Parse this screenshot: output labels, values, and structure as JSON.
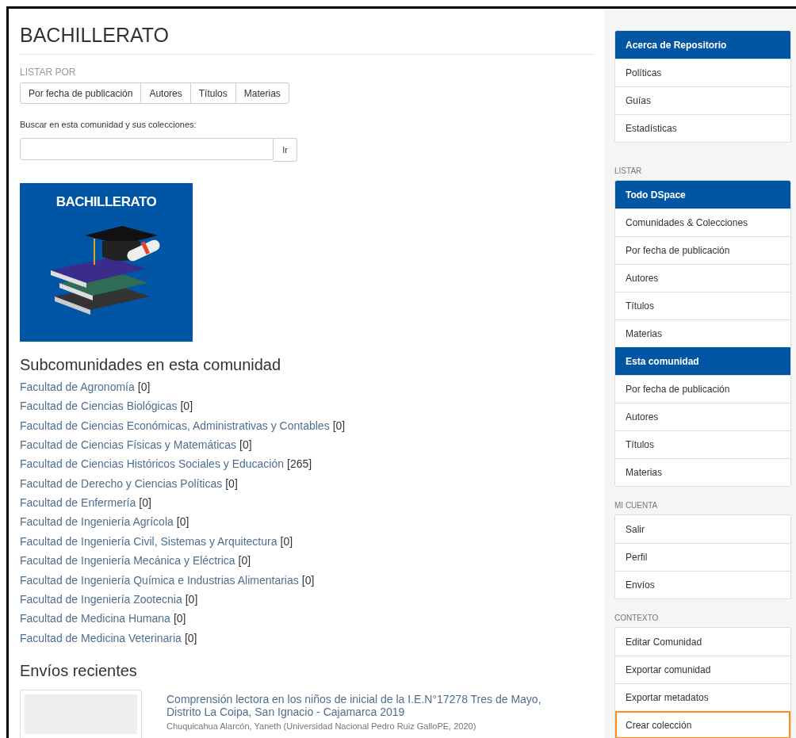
{
  "page_title": "BACHILLERATO",
  "browse": {
    "label": "LISTAR POR",
    "buttons": [
      "Por fecha de publicación",
      "Autores",
      "Títulos",
      "Materias"
    ]
  },
  "search": {
    "label": "Buscar en esta comunidad y sus colecciones:",
    "button": "Ir"
  },
  "logo": {
    "text": "BACHILLERATO"
  },
  "subcommunities": {
    "heading": "Subcomunidades en esta comunidad",
    "items": [
      {
        "name": "Facultad de Agronomía",
        "count": "[0]"
      },
      {
        "name": "Facultad de Ciencias Biológicas",
        "count": "[0]"
      },
      {
        "name": "Facultad de Ciencias Económicas, Administrativas y Contables",
        "count": "[0]"
      },
      {
        "name": "Facultad de Ciencias Físicas y Matemáticas",
        "count": "[0]"
      },
      {
        "name": "Facultad de Ciencias Históricos Sociales y Educación",
        "count": "[265]"
      },
      {
        "name": "Facultad de Derecho y Ciencias Políticas",
        "count": "[0]"
      },
      {
        "name": "Facultad de Enfermería",
        "count": "[0]"
      },
      {
        "name": "Facultad de Ingeniería Agrícola",
        "count": "[0]"
      },
      {
        "name": "Facultad de Ingeniería Civil, Sistemas y Arquitectura",
        "count": "[0]"
      },
      {
        "name": "Facultad de Ingeniería Mecánica y Eléctrica",
        "count": "[0]"
      },
      {
        "name": "Facultad de Ingeniería Química e Industrias Alimentarias",
        "count": "[0]"
      },
      {
        "name": "Facultad de Ingeniería Zootecnia",
        "count": "[0]"
      },
      {
        "name": "Facultad de Medicina Humana",
        "count": "[0]"
      },
      {
        "name": "Facultad de Medicina Veterinaria",
        "count": "[0]"
      }
    ]
  },
  "recent": {
    "heading": "Envíos recientes",
    "items": [
      {
        "title": "Comprensión lectora en los niños de inicial de la I.E.N°17278 Tres de Mayo, Distrito La Coipa, San Ignacio - Cajamarca 2019",
        "authors": "Chuquicahua Alarcón, Yaneth (Universidad Nacional Pedro Ruiz GalloPE, 2020)"
      }
    ]
  },
  "sidebar": [
    {
      "items": [
        {
          "kind": "header",
          "text": "Acerca de Repositorio",
          "focused": false
        },
        {
          "kind": "link",
          "text": "Políticas",
          "focused": false
        },
        {
          "kind": "link",
          "text": "Guías",
          "focused": false
        },
        {
          "kind": "link",
          "text": "Estadísticas",
          "focused": false
        }
      ]
    },
    {
      "label": "LISTAR",
      "items": [
        {
          "kind": "header",
          "text": "Todo DSpace",
          "focused": false
        },
        {
          "kind": "link",
          "text": "Comunidades & Colecciones",
          "focused": false
        },
        {
          "kind": "link",
          "text": "Por fecha de publicación",
          "focused": false
        },
        {
          "kind": "link",
          "text": "Autores",
          "focused": false
        },
        {
          "kind": "link",
          "text": "Títulos",
          "focused": false
        },
        {
          "kind": "link",
          "text": "Materias",
          "focused": false
        },
        {
          "kind": "header",
          "text": "Esta comunidad",
          "focused": false
        },
        {
          "kind": "link",
          "text": "Por fecha de publicación",
          "focused": false
        },
        {
          "kind": "link",
          "text": "Autores",
          "focused": false
        },
        {
          "kind": "link",
          "text": "Títulos",
          "focused": false
        },
        {
          "kind": "link",
          "text": "Materias",
          "focused": false
        }
      ]
    },
    {
      "label": "MI CUENTA",
      "items": [
        {
          "kind": "link",
          "text": "Salir",
          "focused": false
        },
        {
          "kind": "link",
          "text": "Perfil",
          "focused": false
        },
        {
          "kind": "link",
          "text": "Envíos",
          "focused": false
        }
      ]
    },
    {
      "label": "CONTEXTO",
      "items": [
        {
          "kind": "link",
          "text": "Editar Comunidad",
          "focused": false
        },
        {
          "kind": "link",
          "text": "Exportar comunidad",
          "focused": false
        },
        {
          "kind": "link",
          "text": "Exportar metadatos",
          "focused": false
        },
        {
          "kind": "link",
          "text": "Crear colección",
          "focused": true
        }
      ]
    }
  ]
}
